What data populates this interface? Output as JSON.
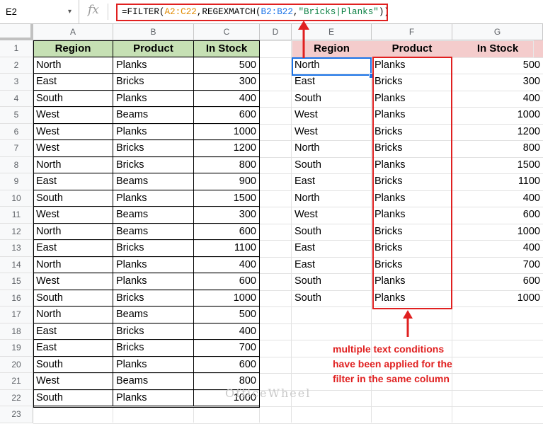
{
  "namebox": {
    "cell": "E2",
    "caret": "▾"
  },
  "formula_bar": {
    "fx_label": "fx",
    "parts": [
      {
        "text": "=FILTER(",
        "color": "#000000"
      },
      {
        "text": "A2:C22",
        "color": "#e08a00"
      },
      {
        "text": ",REGEXMATCH(",
        "color": "#000000"
      },
      {
        "text": "B2:B22",
        "color": "#1a73e8"
      },
      {
        "text": ",",
        "color": "#000000"
      },
      {
        "text": "\"Bricks|Planks\"",
        "color": "#0b8043"
      },
      {
        "text": "))",
        "color": "#000000"
      }
    ]
  },
  "columns": [
    "A",
    "B",
    "C",
    "D",
    "E",
    "F",
    "G"
  ],
  "rows": [
    "1",
    "2",
    "3",
    "4",
    "5",
    "6",
    "7",
    "8",
    "9",
    "10",
    "11",
    "12",
    "13",
    "14",
    "15",
    "16",
    "17",
    "18",
    "19",
    "20",
    "21",
    "22",
    "23"
  ],
  "source_table": {
    "headers": [
      "Region",
      "Product",
      "In Stock"
    ],
    "rows": [
      [
        "North",
        "Planks",
        "500"
      ],
      [
        "East",
        "Bricks",
        "300"
      ],
      [
        "South",
        "Planks",
        "400"
      ],
      [
        "West",
        "Beams",
        "600"
      ],
      [
        "West",
        "Planks",
        "1000"
      ],
      [
        "West",
        "Bricks",
        "1200"
      ],
      [
        "North",
        "Bricks",
        "800"
      ],
      [
        "East",
        "Beams",
        "900"
      ],
      [
        "South",
        "Planks",
        "1500"
      ],
      [
        "West",
        "Beams",
        "300"
      ],
      [
        "North",
        "Beams",
        "600"
      ],
      [
        "East",
        "Bricks",
        "1100"
      ],
      [
        "North",
        "Planks",
        "400"
      ],
      [
        "West",
        "Planks",
        "600"
      ],
      [
        "South",
        "Bricks",
        "1000"
      ],
      [
        "North",
        "Beams",
        "500"
      ],
      [
        "East",
        "Bricks",
        "400"
      ],
      [
        "East",
        "Bricks",
        "700"
      ],
      [
        "South",
        "Planks",
        "600"
      ],
      [
        "West",
        "Beams",
        "800"
      ],
      [
        "South",
        "Planks",
        "1000"
      ]
    ]
  },
  "result_table": {
    "headers": [
      "Region",
      "Product",
      "In Stock"
    ],
    "rows": [
      [
        "North",
        "Planks",
        "500"
      ],
      [
        "East",
        "Bricks",
        "300"
      ],
      [
        "South",
        "Planks",
        "400"
      ],
      [
        "West",
        "Planks",
        "1000"
      ],
      [
        "West",
        "Bricks",
        "1200"
      ],
      [
        "North",
        "Bricks",
        "800"
      ],
      [
        "South",
        "Planks",
        "1500"
      ],
      [
        "East",
        "Bricks",
        "1100"
      ],
      [
        "North",
        "Planks",
        "400"
      ],
      [
        "West",
        "Planks",
        "600"
      ],
      [
        "South",
        "Bricks",
        "1000"
      ],
      [
        "East",
        "Bricks",
        "400"
      ],
      [
        "East",
        "Bricks",
        "700"
      ],
      [
        "South",
        "Planks",
        "600"
      ],
      [
        "South",
        "Planks",
        "1000"
      ]
    ]
  },
  "annotation": {
    "lines": [
      "multiple text conditions",
      "have been applied for the",
      "filter in the same column"
    ]
  },
  "watermark": "OfficeWheel",
  "colors": {
    "source_header": "#c6e0b4",
    "result_header": "#f4cccc",
    "highlight": "#e02020",
    "selection": "#1a73e8"
  }
}
